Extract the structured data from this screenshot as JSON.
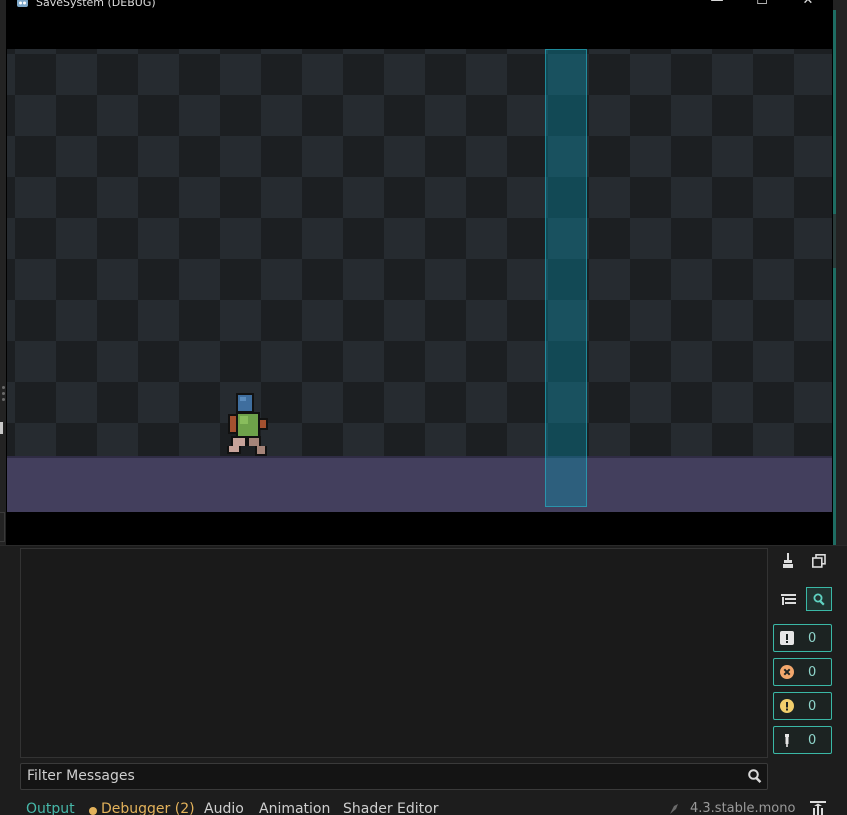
{
  "window": {
    "title": "SaveSystem (DEBUG)",
    "minimize_glyph": "—",
    "maximize_glyph": "☐",
    "close_glyph": "✕"
  },
  "colors": {
    "accent": "#3ab8a6",
    "ground": "#433f5d",
    "teleport_zone": "#0aa0be",
    "warning_yellow": "#e3b25b"
  },
  "toolbar": {
    "icons": [
      "clear-output-icon",
      "copy-icon",
      "toggle-timestamps-icon",
      "search-icon"
    ]
  },
  "filters": [
    {
      "icon": "message-icon",
      "count": "0"
    },
    {
      "icon": "error-icon",
      "count": "0"
    },
    {
      "icon": "warning-icon",
      "count": "0"
    },
    {
      "icon": "editor-message-icon",
      "count": "0"
    }
  ],
  "filter_input": {
    "placeholder": "Filter Messages"
  },
  "bottom_tabs": {
    "output": "Output",
    "debugger": "Debugger (2)",
    "audio": "Audio",
    "animation": "Animation",
    "shader_editor": "Shader Editor"
  },
  "status": {
    "version": "4.3.stable.mono"
  }
}
